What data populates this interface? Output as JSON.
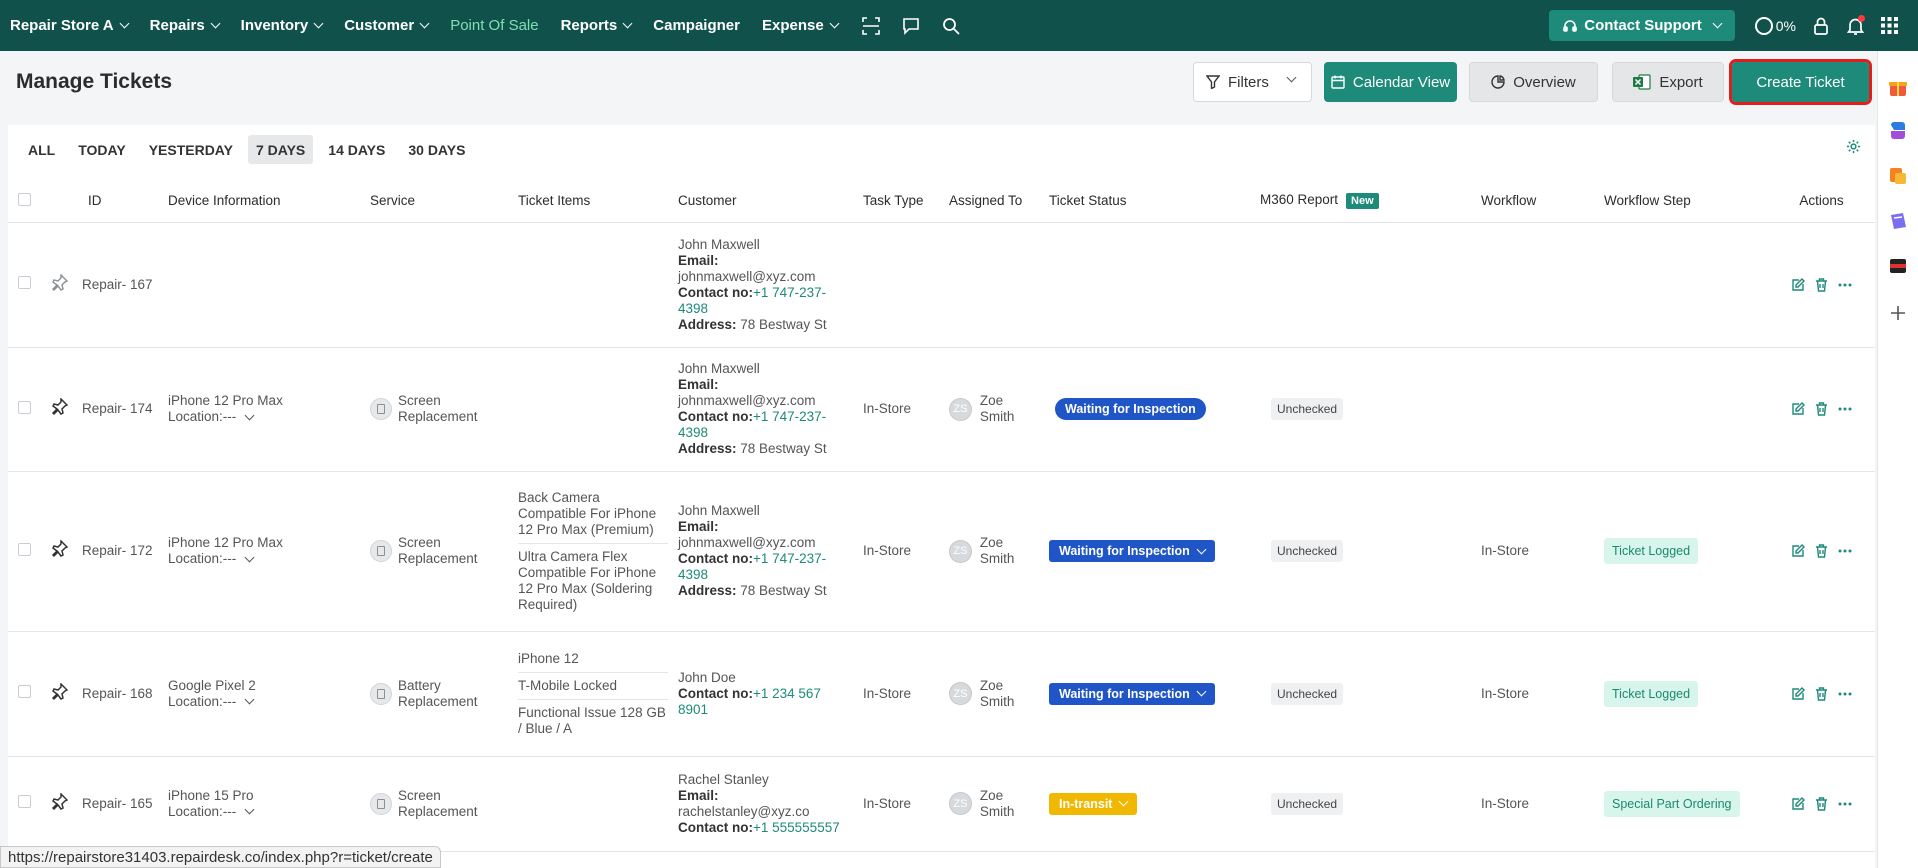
{
  "nav": {
    "store": "Repair Store A",
    "items": [
      "Repairs",
      "Inventory",
      "Customer",
      "Point Of Sale",
      "Reports",
      "Campaigner",
      "Expense"
    ],
    "support": "Contact Support",
    "progress": "0%"
  },
  "header": {
    "title": "Manage Tickets",
    "filters": "Filters",
    "calendar": "Calendar View",
    "overview": "Overview",
    "export": "Export",
    "create": "Create Ticket"
  },
  "tabs": [
    "ALL",
    "TODAY",
    "YESTERDAY",
    "7 DAYS",
    "14 DAYS",
    "30 DAYS"
  ],
  "selected_tab": "7 DAYS",
  "columns": {
    "id": "ID",
    "device": "Device Information",
    "service": "Service",
    "items": "Ticket Items",
    "customer": "Customer",
    "task": "Task Type",
    "assigned": "Assigned To",
    "status": "Ticket Status",
    "m360": "M360 Report",
    "new_badge": "New",
    "workflow": "Workflow",
    "step": "Workflow Step",
    "actions": "Actions"
  },
  "labels": {
    "email": "Email:",
    "contact": "Contact no:",
    "address": "Address:"
  },
  "rows": [
    {
      "id": "Repair- 167",
      "device": "",
      "location": "",
      "service": "",
      "items": [],
      "customer": {
        "name": "John Maxwell",
        "email": "johnmaxwell@xyz.com",
        "phone": "+1 747-237-4398",
        "address": "78 Bestway St"
      },
      "task": "",
      "assigned": {
        "initials": "",
        "name": ""
      },
      "status": "",
      "m360": "",
      "workflow": "",
      "step": ""
    },
    {
      "id": "Repair- 174",
      "device": "iPhone 12 Pro Max",
      "location": "Location:---",
      "service": "Screen Replacement",
      "items": [],
      "customer": {
        "name": "John Maxwell",
        "email": "johnmaxwell@xyz.com",
        "phone": "+1 747-237-4398",
        "address": "78 Bestway St"
      },
      "task": "In-Store",
      "assigned": {
        "initials": "ZS",
        "name": "Zoe Smith"
      },
      "status": "Waiting for Inspection",
      "m360": "Unchecked",
      "workflow": "",
      "step": ""
    },
    {
      "id": "Repair- 172",
      "device": "iPhone 12 Pro Max",
      "location": "Location:---",
      "service": "Screen Replacement",
      "items": [
        "Back Camera Compatible For iPhone 12 Pro Max (Premium)",
        "Ultra Camera Flex Compatible For iPhone 12 Pro Max (Soldering Required)"
      ],
      "customer": {
        "name": "John Maxwell",
        "email": "johnmaxwell@xyz.com",
        "phone": "+1 747-237-4398",
        "address": "78 Bestway St"
      },
      "task": "In-Store",
      "assigned": {
        "initials": "ZS",
        "name": "Zoe Smith"
      },
      "status": "Waiting for Inspection",
      "m360": "Unchecked",
      "workflow": "In-Store",
      "step": "Ticket Logged"
    },
    {
      "id": "Repair- 168",
      "device": "Google Pixel 2",
      "location": "Location:---",
      "service": "Battery Replacement",
      "items": [
        "iPhone 12",
        "T-Mobile Locked",
        "Functional Issue 128 GB / Blue / A"
      ],
      "customer": {
        "name": "John Doe",
        "email": "",
        "phone": "+1 234 567 8901",
        "address": ""
      },
      "task": "In-Store",
      "assigned": {
        "initials": "ZS",
        "name": "Zoe Smith"
      },
      "status": "Waiting for Inspection",
      "m360": "Unchecked",
      "workflow": "In-Store",
      "step": "Ticket Logged"
    },
    {
      "id": "Repair- 165",
      "device": "iPhone 15 Pro",
      "location": "Location:---",
      "service": "Screen Replacement",
      "items": [],
      "customer": {
        "name": "Rachel Stanley",
        "email": "rachelstanley@xyz.co",
        "phone": "+1 555555557",
        "address": ""
      },
      "task": "In-Store",
      "assigned": {
        "initials": "ZS",
        "name": "Zoe Smith"
      },
      "status": "In-transit",
      "m360": "Unchecked",
      "workflow": "In-Store",
      "step": "Special Part Ordering"
    }
  ],
  "status_url": "https://repairstore31403.repairdesk.co/index.php?r=ticket/create",
  "colors": {
    "nav": "#10524b",
    "accent": "#1d8a7a",
    "status_blue": "#1f55c6",
    "status_amber": "#f0b800",
    "highlight": "#e01e1e"
  }
}
